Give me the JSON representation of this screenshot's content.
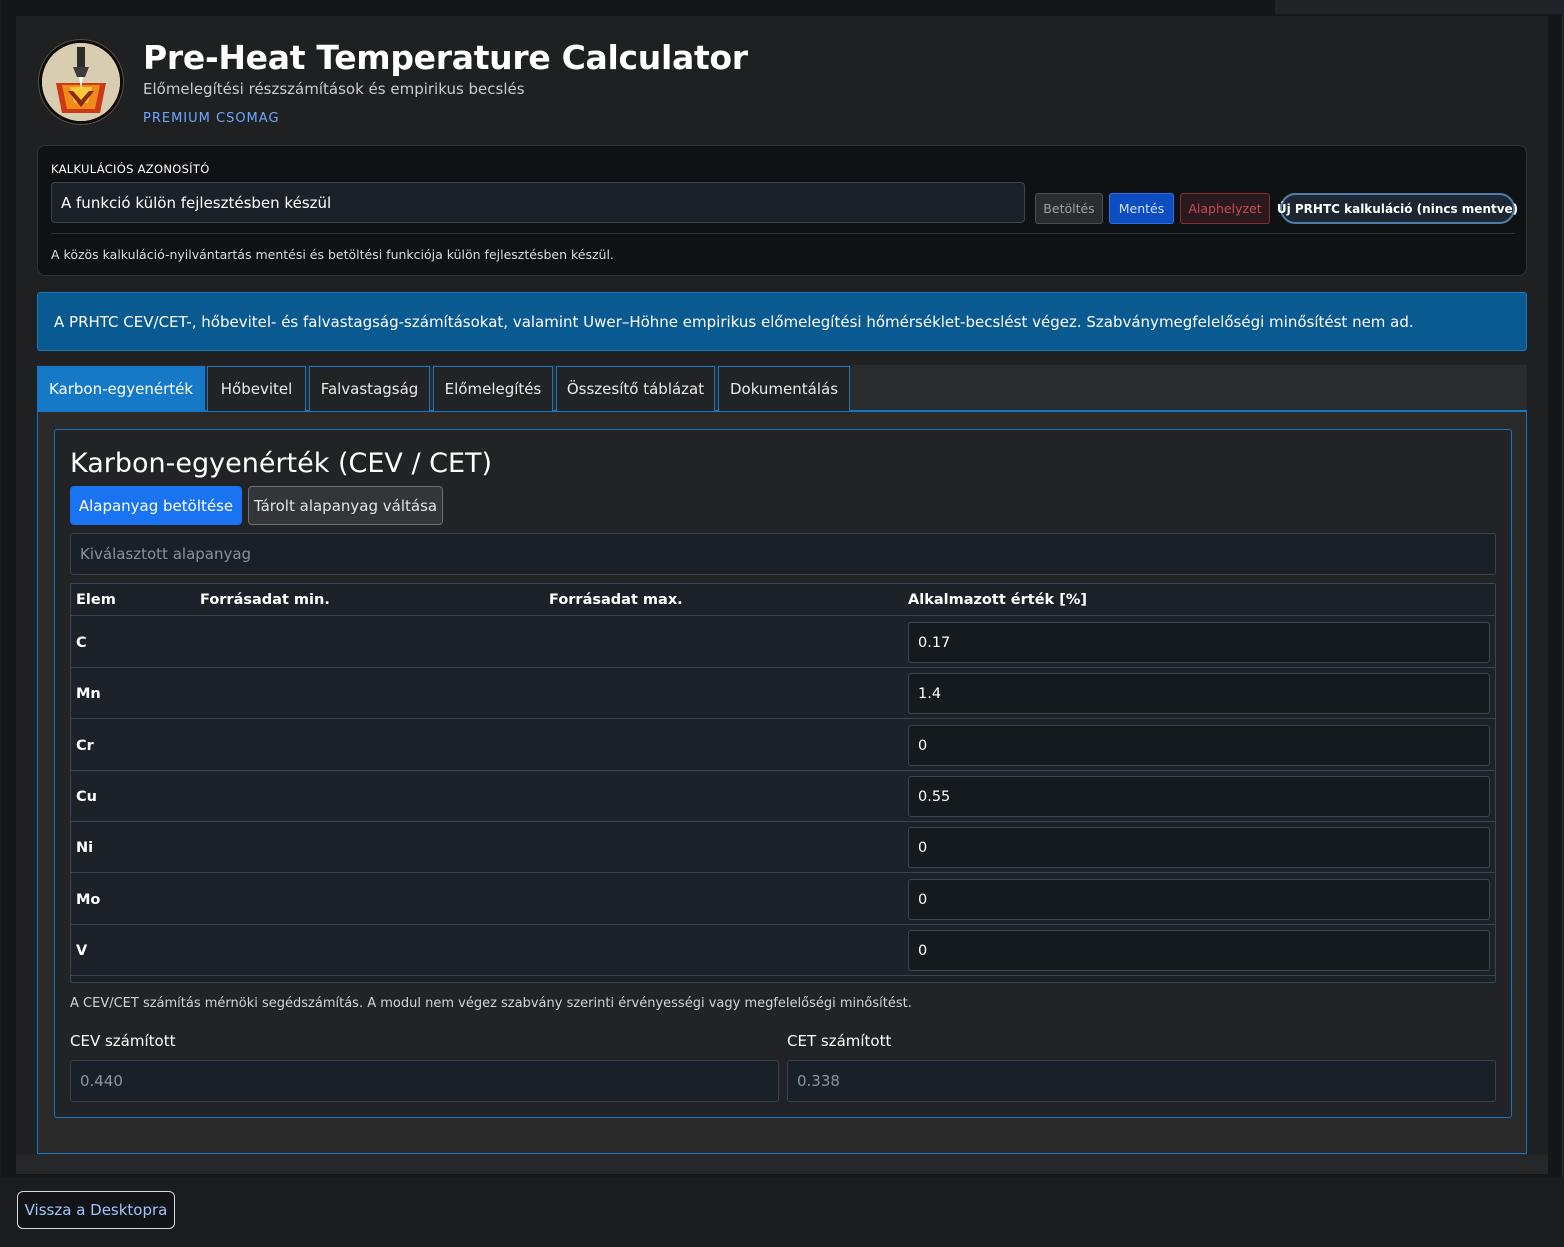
{
  "header": {
    "title": "Pre-Heat Temperature Calculator",
    "subtitle": "Előmelegítési részszámítások és empirikus becslés",
    "badge": "PREMIUM CSOMAG"
  },
  "id_card": {
    "label": "KALKULÁCIÓS AZONOSÍTÓ",
    "input_value": "A funkció külön fejlesztésben készül",
    "load_label": "Betöltés",
    "save_label": "Mentés",
    "reset_label": "Alaphelyzet",
    "new_label": "Új PRHTC kalkuláció (nincs mentve)",
    "note": "A közös kalkuláció-nyilvántartás mentési és betöltési funkciója külön fejlesztésben készül."
  },
  "info_banner": "A PRHTC CEV/CET-, hőbevitel- és falvastagság-számításokat, valamint Uwer–Höhne empirikus előmelegítési hőmérséklet-becslést végez. Szabványmegfelelőségi minősítést nem ad.",
  "tabs": [
    {
      "label": "Karbon-egyenérték"
    },
    {
      "label": "Hőbevitel"
    },
    {
      "label": "Falvastagság"
    },
    {
      "label": "Előmelegítés"
    },
    {
      "label": "Összesítő táblázat"
    },
    {
      "label": "Dokumentálás"
    }
  ],
  "section": {
    "title": "Karbon-egyenérték (CEV / CET)",
    "load_material_label": "Alapanyag betöltése",
    "switch_material_label": "Tárolt alapanyag váltása",
    "material_placeholder": "Kiválasztott alapanyag",
    "table": {
      "headers": [
        "Elem",
        "Forrásadat min.",
        "Forrásadat max.",
        "Alkalmazott érték [%]"
      ],
      "rows": [
        {
          "element": "C",
          "value": "0.17"
        },
        {
          "element": "Mn",
          "value": "1.4"
        },
        {
          "element": "Cr",
          "value": "0"
        },
        {
          "element": "Cu",
          "value": "0.55"
        },
        {
          "element": "Ni",
          "value": "0"
        },
        {
          "element": "Mo",
          "value": "0"
        },
        {
          "element": "V",
          "value": "0"
        }
      ]
    },
    "note": "A CEV/CET számítás mérnöki segédszámítás. A modul nem végez szabvány szerinti érvényességi vagy megfelelőségi minősítést.",
    "cev_label": "CEV számított",
    "cev_value": "0.440",
    "cet_label": "CET számított",
    "cet_value": "0.338"
  },
  "footer": {
    "back_label": "Vissza a Desktopra"
  },
  "colors": {
    "accent": "#1776c4",
    "primary_button": "#1a73f0",
    "info_banner": "#0a5a92",
    "danger": "#c74a58"
  }
}
